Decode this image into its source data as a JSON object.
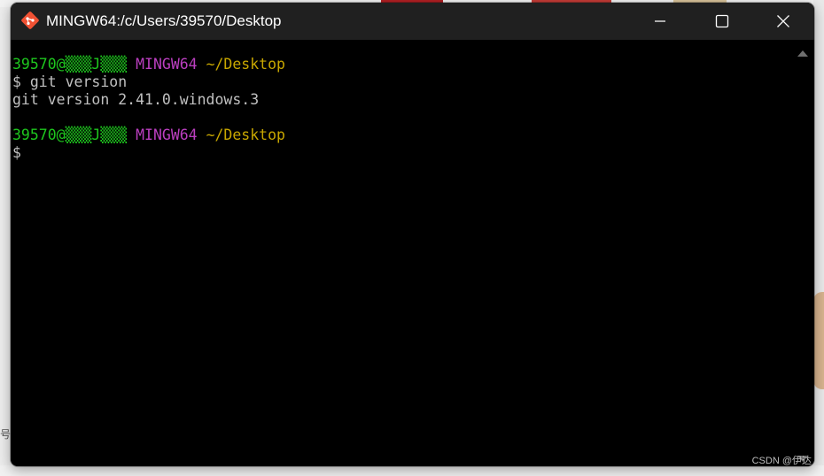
{
  "window": {
    "title": "MINGW64:/c/Users/39570/Desktop",
    "icon": "git-bash-icon"
  },
  "controls": {
    "minimize_icon": "minimize-icon",
    "maximize_icon": "maximize-icon",
    "close_icon": "close-icon"
  },
  "terminal": {
    "prompt1": {
      "user_host": "39570@▒▒▒J▒▒▒",
      "system": "MINGW64",
      "path": "~/Desktop"
    },
    "command1": "$ git version",
    "output1": "git version 2.41.0.windows.3",
    "prompt2": {
      "user_host": "39570@▒▒▒J▒▒▒",
      "system": "MINGW64",
      "path": "~/Desktop"
    },
    "input_line": "$"
  },
  "colors": {
    "user_host": "#1ec71e",
    "system": "#bb3fc0",
    "path": "#c8a700",
    "text": "#c0c0c0",
    "titlebar": "#202020",
    "background": "#000000"
  },
  "watermark": "CSDN @伊达",
  "background_text": "号"
}
